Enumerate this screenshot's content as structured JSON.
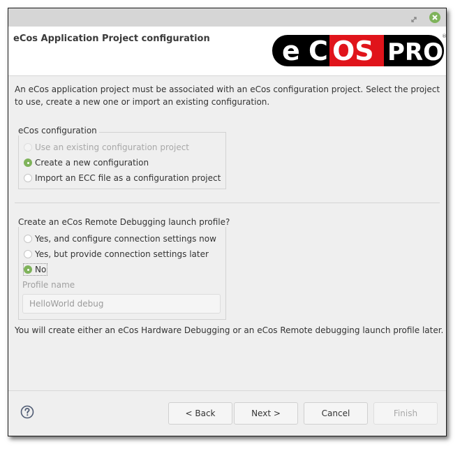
{
  "window": {
    "titlebar": {
      "restore_icon": "restore-icon",
      "close_icon": "close-icon"
    },
    "header": {
      "title": "eCos Application Project configuration",
      "logo": {
        "part1": "e",
        "part2": "C",
        "part3": "OS",
        "part4": "PRO",
        "registered": "®",
        "colors": {
          "black": "#000000",
          "red": "#e0141b",
          "white": "#ffffff"
        }
      }
    },
    "description": "An eCos application project must be associated with an eCos configuration project. Select the project to use, create a new one or import an existing configuration.",
    "configuration_group": {
      "legend": "eCos configuration",
      "options": [
        {
          "label": "Use an existing configuration project",
          "checked": false,
          "disabled": true
        },
        {
          "label": "Create a new configuration",
          "checked": true,
          "disabled": false
        },
        {
          "label": "Import an ECC file as a configuration project",
          "checked": false,
          "disabled": false
        }
      ]
    },
    "debug_group": {
      "legend": "Create an eCos Remote Debugging launch profile?",
      "options": [
        {
          "label": "Yes, and configure connection settings now",
          "checked": false,
          "disabled": false
        },
        {
          "label": "Yes, but provide connection settings later",
          "checked": false,
          "disabled": false
        },
        {
          "label": "No",
          "checked": true,
          "disabled": false
        }
      ],
      "profile_name_label": "Profile name",
      "profile_name_value": "HelloWorld debug"
    },
    "note": "You will create either an eCos Hardware Debugging or an eCos Remote debugging launch profile later.",
    "footer": {
      "help_icon": "help-icon",
      "back_label": "< Back",
      "next_label": "Next >",
      "cancel_label": "Cancel",
      "finish_label": "Finish"
    },
    "accent_color": "#7fb35b"
  }
}
